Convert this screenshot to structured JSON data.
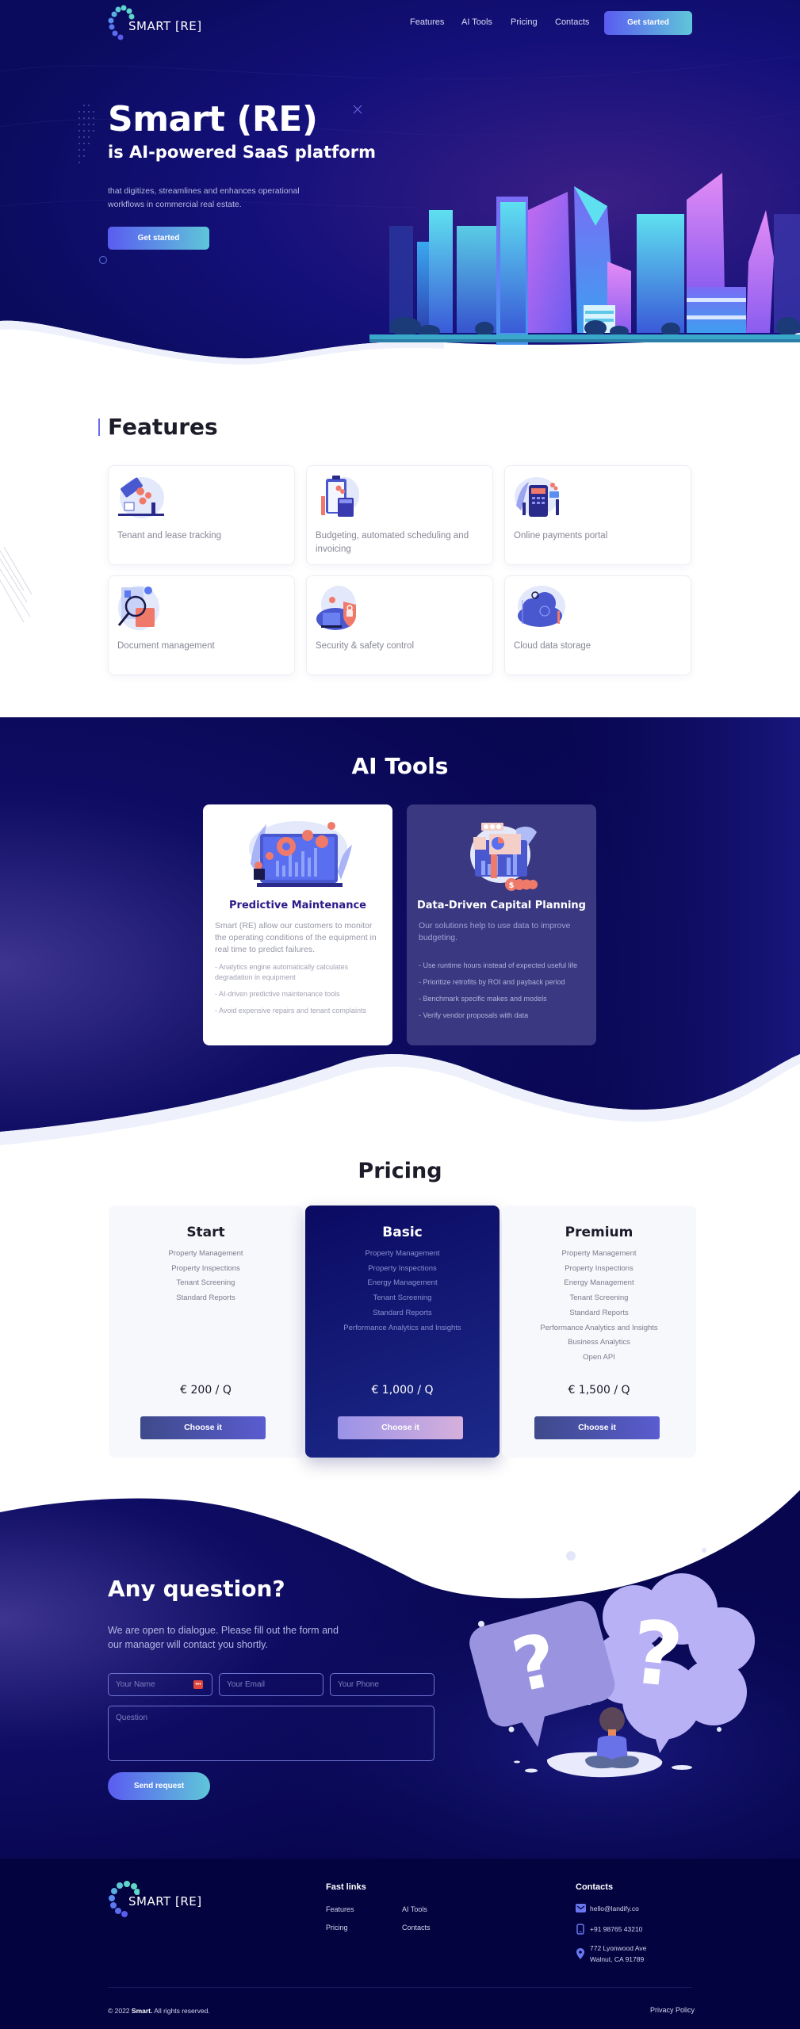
{
  "brand": {
    "name": "SMART [RE]"
  },
  "nav": {
    "items": [
      {
        "label": "Features"
      },
      {
        "label": "AI Tools"
      },
      {
        "label": "Pricing"
      },
      {
        "label": "Contacts"
      }
    ],
    "cta_label": "Get started"
  },
  "hero": {
    "title": "Smart (RE)",
    "subtitle": "is AI-powered SaaS platform",
    "description": "that digitizes, streamlines and enhances operational workflows in commercial real estate.",
    "cta_label": "Get started",
    "illustration": "city-skyline-illustration"
  },
  "features": {
    "title": "Features",
    "items": [
      {
        "label": "Tenant and lease tracking",
        "icon": "money-lease-illustration"
      },
      {
        "label": "Budgeting, automated scheduling and invoicing",
        "icon": "clipboard-calculator-illustration"
      },
      {
        "label": "Online payments portal",
        "icon": "payment-terminal-illustration"
      },
      {
        "label": "Document management",
        "icon": "magnifier-document-illustration"
      },
      {
        "label": "Security & safety control",
        "icon": "shield-lock-illustration"
      },
      {
        "label": "Cloud data storage",
        "icon": "cloud-storage-illustration"
      }
    ]
  },
  "ai_tools": {
    "title": "AI Tools",
    "cards": [
      {
        "title": "Predictive Maintenance",
        "description": "Smart (RE) allow our customers to monitor the operating conditions of the equipment in real time to predict failures.",
        "bullets": [
          "- Analytics engine automatically calculates degradation in equipment",
          "- AI-driven predictive maintenance tools",
          "- Avoid expensive repairs and tenant complaints"
        ]
      },
      {
        "title": "Data-Driven Capital Planning",
        "description": "Our solutions help to use data to improve budgeting.",
        "bullets": [
          "- Use runtime hours instead of expected useful life",
          "- Prioritize retrofits by ROI and payback period",
          "- Benchmark specific makes and models",
          "- Verify vendor proposals with data"
        ]
      }
    ]
  },
  "pricing": {
    "title": "Pricing",
    "plans": [
      {
        "name": "Start",
        "features": [
          "Property Management",
          "Property Inspections",
          "Tenant Screening",
          "Standard Reports"
        ],
        "price": "€ 200 / Q",
        "button_label": "Choose it"
      },
      {
        "name": "Basic",
        "features": [
          "Property Management",
          "Property Inspections",
          "Energy Management",
          "Tenant Screening",
          "Standard Reports",
          "Performance Analytics and Insights"
        ],
        "price": "€ 1,000 / Q",
        "button_label": "Choose it"
      },
      {
        "name": "Premium",
        "features": [
          "Property Management",
          "Property Inspections",
          "Energy Management",
          "Tenant Screening",
          "Standard Reports",
          "Performance Analytics and Insights",
          "Business Analytics",
          "Open API"
        ],
        "price": "€ 1,500 / Q",
        "button_label": "Choose it"
      }
    ]
  },
  "contact": {
    "title": "Any question?",
    "description": "We are open to dialogue. Please fill out the form and our manager will contact you shortly.",
    "fields": {
      "name_placeholder": "Your Name",
      "email_placeholder": "Your Email",
      "phone_placeholder": "Your Phone",
      "question_placeholder": "Question"
    },
    "submit_label": "Send request"
  },
  "footer": {
    "fast_links_title": "Fast links",
    "fast_links": [
      "Features",
      "AI Tools",
      "Pricing",
      "Contacts"
    ],
    "contacts_title": "Contacts",
    "email": "hello@landify.co",
    "phone": "+91 98765 43210",
    "address_line1": "772 Lyonwood Ave",
    "address_line2": "Walnut, CA 91789",
    "copyright_prefix": "© 2022 ",
    "copyright_brand": "Smart.",
    "copyright_suffix": " All rights reserved.",
    "privacy_label": "Privacy Policy"
  },
  "colors": {
    "navy": "#07064f",
    "accent_start": "#5a5cf0",
    "accent_end": "#5fc6d9",
    "heading": "#1c1c2a",
    "card_title_purple": "#2b1a8a"
  }
}
